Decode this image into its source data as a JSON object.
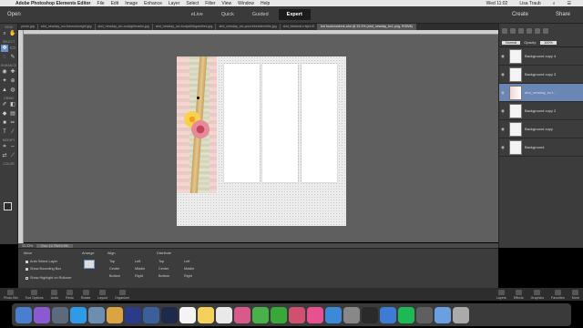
{
  "menubar": {
    "app_name": "Adobe Photoshop Elements Editor",
    "items": [
      "File",
      "Edit",
      "Image",
      "Enhance",
      "Layer",
      "Select",
      "Filter",
      "View",
      "Window",
      "Help"
    ],
    "clock": "Wed 11:02",
    "user": "Lisa Traub"
  },
  "header": {
    "open_label": "Open",
    "modes": [
      "eLive",
      "Quick",
      "Guided",
      "Expert"
    ],
    "active_mode": "Expert",
    "create_label": "Create",
    "share_label": "Share"
  },
  "tabs": [
    "photo.jpg",
    "ahd_newday_wo-futurooksright.jpg",
    "ahd_newday_wo-coolightmarks.jpg",
    "ahd_newday_wo-bodyslhtbgabdiles.jpg",
    "ahd_newday_wo-yourrebelelemeilts.jpg",
    "ahd_bkdsedt-rrlsjt4.tif",
    "bot bookmarkers.ahd @ 33.3% (ahd_newday_bc1.png, RGB/8)"
  ],
  "toolbox": {
    "sections": [
      "VIEW",
      "SELECT",
      "ENHANCE",
      "DRAW",
      "MODIFY",
      "COLOR"
    ]
  },
  "status": {
    "zoom": "33.33%",
    "doc_size": "Doc: 12.7M/13.0M"
  },
  "layers_panel": {
    "blend_mode": "Normal",
    "opacity_label": "Opacity:",
    "opacity_value": "100%",
    "layers": [
      {
        "name": "Background copy 4",
        "active": false
      },
      {
        "name": "Background copy 3",
        "active": false
      },
      {
        "name": "ahd_newday_bc1...",
        "active": true
      },
      {
        "name": "Background copy 2",
        "active": false
      },
      {
        "name": "Background copy",
        "active": false
      },
      {
        "name": "Background",
        "active": false
      }
    ]
  },
  "tool_options": {
    "move_label": "Move",
    "auto_select": "Auto Select Layer",
    "bounding_box": "Show Bounding Box",
    "highlight": "Show Highlight on Rollover",
    "arrange_label": "Arrange",
    "align_label": "Align",
    "distribute_label": "Distribute",
    "align_top": "Top",
    "align_center": "Center",
    "align_bottom": "Bottom",
    "align_left": "Left",
    "align_middle": "Middle",
    "align_right": "Right"
  },
  "taskbar": {
    "left": [
      "Photo Bin",
      "Tool Options",
      "Undo",
      "Redo",
      "Rotate",
      "Layout",
      "Organizer"
    ],
    "right": [
      "Layers",
      "Effects",
      "Graphics",
      "Favorites",
      "More"
    ]
  }
}
